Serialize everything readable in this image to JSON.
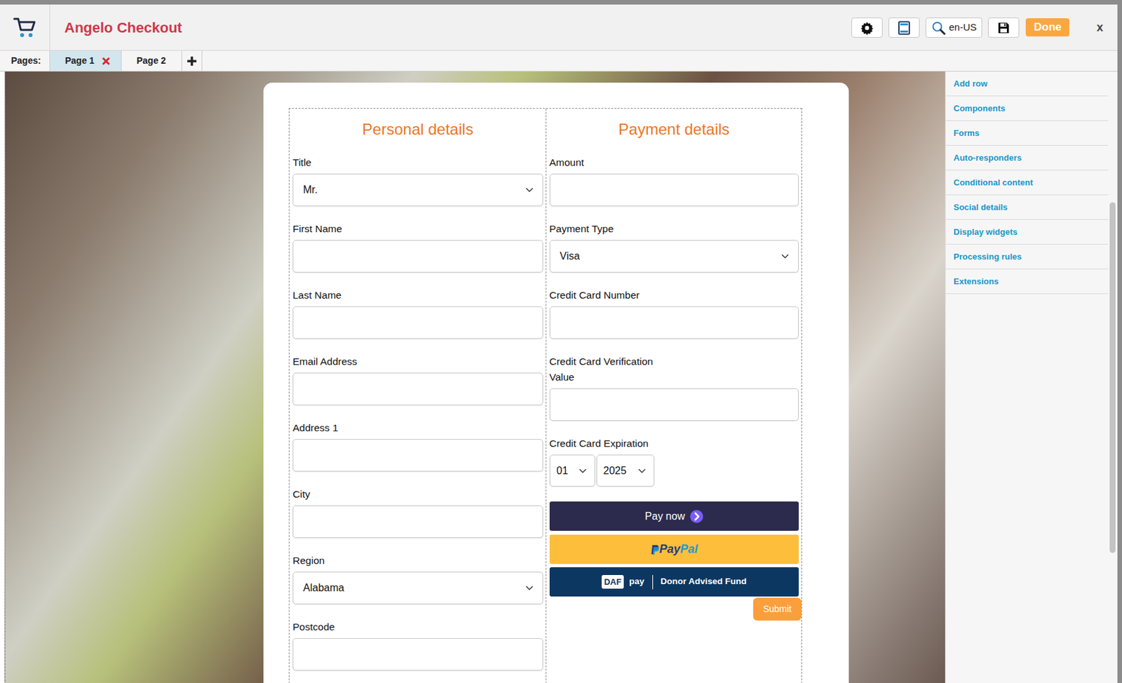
{
  "app": {
    "title": "Angelo Checkout"
  },
  "toolbar": {
    "locale": "en-US",
    "done": "Done",
    "close": "x"
  },
  "pages": {
    "label": "Pages:",
    "tabs": [
      {
        "label": "Page 1",
        "selected": true
      },
      {
        "label": "Page 2",
        "selected": false
      }
    ]
  },
  "sidebar": {
    "items": [
      "Add row",
      "Components",
      "Forms",
      "Auto-responders",
      "Conditional content",
      "Social details",
      "Display widgets",
      "Processing rules",
      "Extensions"
    ]
  },
  "form": {
    "columns": [
      {
        "heading": "Personal details",
        "fields": [
          {
            "label": "Title",
            "kind": "select",
            "value": "Mr."
          },
          {
            "label": "First Name",
            "kind": "text"
          },
          {
            "label": "Last Name",
            "kind": "text"
          },
          {
            "label": "Email Address",
            "kind": "text"
          },
          {
            "label": "Address 1",
            "kind": "text"
          },
          {
            "label": "City",
            "kind": "text"
          },
          {
            "label": "Region",
            "kind": "select",
            "value": "Alabama"
          },
          {
            "label": "Postcode",
            "kind": "text"
          }
        ]
      },
      {
        "heading": "Payment details",
        "fields": [
          {
            "label": "Amount",
            "kind": "text"
          },
          {
            "label": "Payment Type",
            "kind": "select",
            "value": "Visa"
          },
          {
            "label": "Credit Card Number",
            "kind": "text"
          },
          {
            "label": "Credit Card Verification Value",
            "kind": "text"
          },
          {
            "label": "Credit Card Expiration",
            "kind": "expiry",
            "values": [
              "01",
              "2025"
            ]
          }
        ]
      }
    ]
  },
  "pay_buttons": {
    "pay_now": "Pay now",
    "paypal": {
      "p": "Pay",
      "pal": "Pal"
    },
    "daf": {
      "badge": "DAF",
      "pay": "pay",
      "label": "Donor Advised Fund"
    }
  },
  "submit": "Submit"
}
